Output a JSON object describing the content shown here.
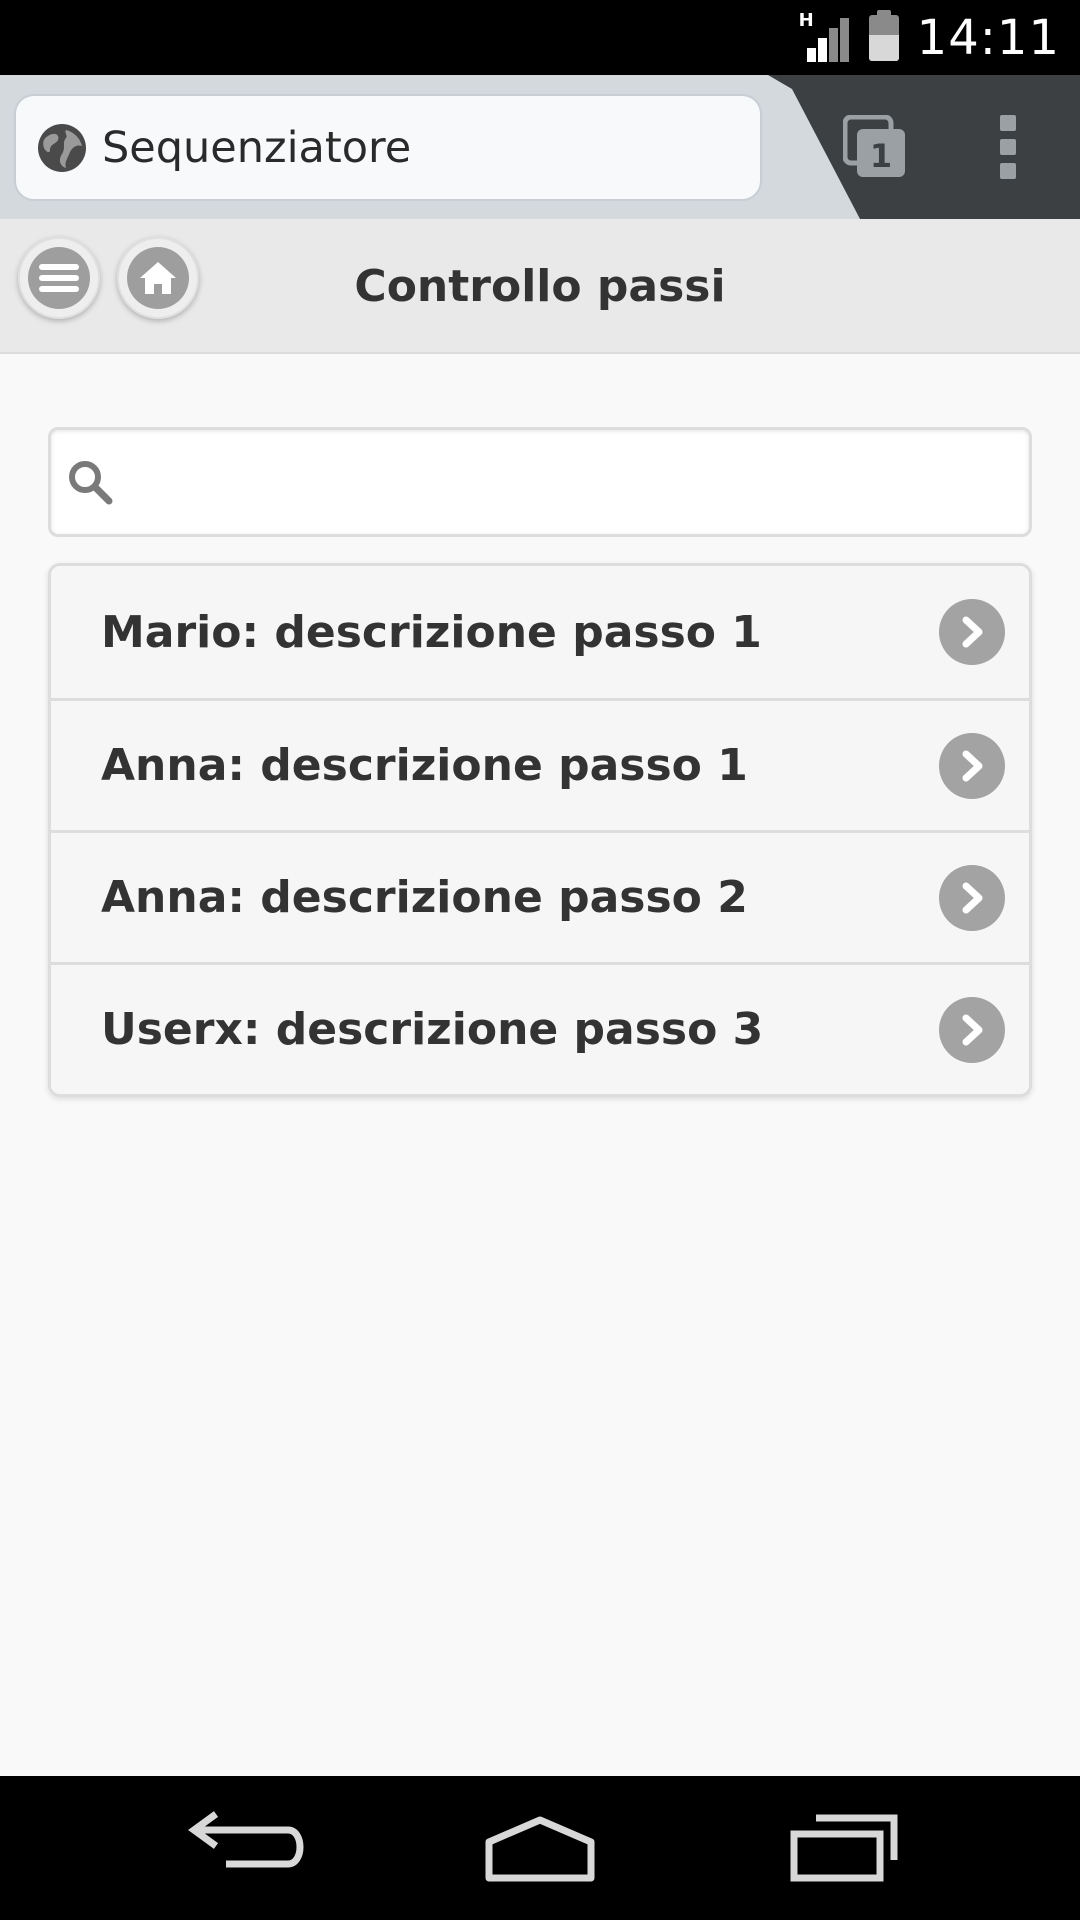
{
  "status_bar": {
    "time": "14:11",
    "network_type": "H"
  },
  "browser": {
    "url_title": "Sequenziatore",
    "tab_count": "1"
  },
  "header": {
    "title": "Controllo passi"
  },
  "search": {
    "value": "",
    "placeholder": ""
  },
  "list": {
    "items": [
      {
        "label": "Mario: descrizione passo 1"
      },
      {
        "label": "Anna: descrizione passo 1"
      },
      {
        "label": "Anna: descrizione passo 2"
      },
      {
        "label": "Userx: descrizione passo 3"
      }
    ]
  },
  "icons": {
    "globe": "globe-icon",
    "tabs": "tabs-icon",
    "menu": "more-vert-icon",
    "bars": "bars-icon",
    "home": "home-icon",
    "search": "search-icon",
    "chevron": "chevron-right-icon",
    "back": "back-icon",
    "nav_home": "nav-home-icon",
    "recents": "recents-icon"
  },
  "colors": {
    "status_bar_bg": "#000000",
    "browser_toolbar_bg": "#3d4043",
    "tab_bg": "#d4d9de",
    "header_bg": "#e9e9e9",
    "list_item_bg": "#f6f6f6",
    "icon_disc": "#a3a3a3"
  }
}
